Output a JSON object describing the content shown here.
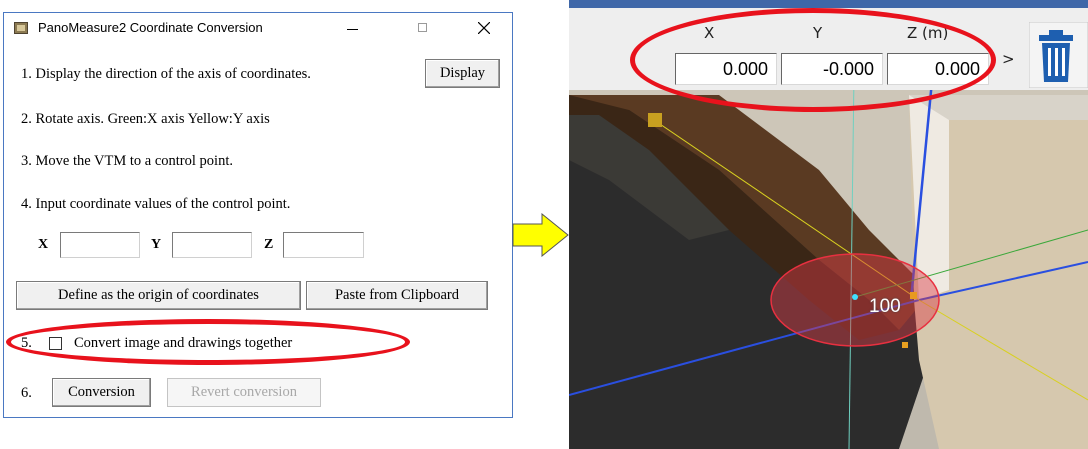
{
  "dialog": {
    "title": "PanoMeasure2 Coordinate Conversion",
    "controls": {
      "minimize": "minimize",
      "maximize": "maximize",
      "close": "close"
    },
    "step1": {
      "text": "1. Display the direction of the axis of coordinates.",
      "button": "Display"
    },
    "step2": {
      "text": "2. Rotate axis. Green:X axis  Yellow:Y axis"
    },
    "step3": {
      "text": "3. Move the VTM to a control point."
    },
    "step4": {
      "text": "4. Input coordinate values of the control point.",
      "x_label": "X",
      "y_label": "Y",
      "z_label": "Z",
      "x_value": "",
      "y_value": "",
      "z_value": ""
    },
    "define_origin_button": "Define as the origin of coordinates",
    "paste_button": "Paste from Clipboard",
    "step5": {
      "number": "5.",
      "checkbox_label": "Convert image and drawings together",
      "checked": false
    },
    "step6": {
      "number": "6.",
      "conversion_button": "Conversion",
      "revert_button": "Revert conversion"
    }
  },
  "viewer": {
    "coords": {
      "x_header": "X",
      "y_header": "Y",
      "z_header": "Z (m)",
      "x_value": "0.000",
      "y_value": "-0.000",
      "z_value": "0.000"
    },
    "more_button": ">",
    "marker_label": "100"
  },
  "colors": {
    "highlight": "#e8121c",
    "arrow": "#ffff00",
    "axis_blue": "#2a4fe0",
    "axis_green": "#3aa83a",
    "axis_yellow": "#d8d020",
    "axis_cyan": "#6fd0c0",
    "window_border": "#4a78c2"
  },
  "icons": [
    "app-icon",
    "trash-icon",
    "arrow-right-icon",
    "close-icon"
  ]
}
